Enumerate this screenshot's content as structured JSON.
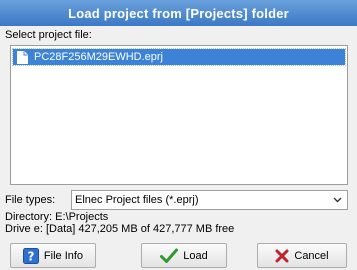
{
  "window": {
    "title": "Load project from [Projects] folder"
  },
  "file_list": {
    "label": "Select project file:",
    "items": [
      {
        "name": "PC28F256M29EWHD.eprj",
        "selected": true
      }
    ]
  },
  "file_types": {
    "label": "File types:",
    "selected": "Elnec Project files (*.eprj)"
  },
  "info": {
    "directory": "Directory: E:\\Projects",
    "drive": "Drive e: [Data]  427,205 MB of 427,777 MB free"
  },
  "buttons": {
    "file_info": "File Info",
    "load": "Load",
    "cancel": "Cancel"
  },
  "colors": {
    "title_bar": "#3b78c6",
    "selection": "#3c83d8",
    "load_check": "#2e9a2e",
    "cancel_x": "#c0242b"
  },
  "icons": {
    "file": "document-icon",
    "file_info": "help-question-icon",
    "load": "checkmark-icon",
    "cancel": "x-icon"
  }
}
